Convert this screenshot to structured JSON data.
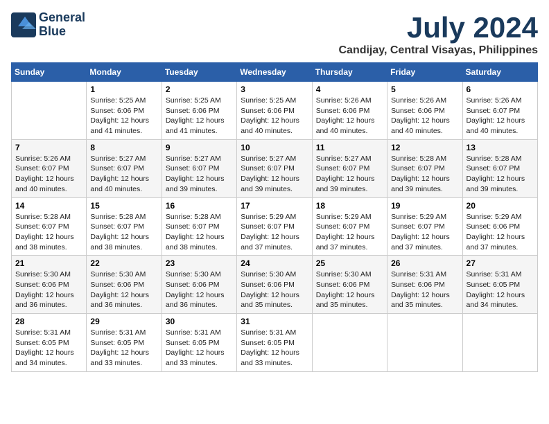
{
  "header": {
    "logo_line1": "General",
    "logo_line2": "Blue",
    "month_year": "July 2024",
    "location": "Candijay, Central Visayas, Philippines"
  },
  "days_of_week": [
    "Sunday",
    "Monday",
    "Tuesday",
    "Wednesday",
    "Thursday",
    "Friday",
    "Saturday"
  ],
  "weeks": [
    [
      {
        "num": "",
        "text": ""
      },
      {
        "num": "1",
        "text": "Sunrise: 5:25 AM\nSunset: 6:06 PM\nDaylight: 12 hours\nand 41 minutes."
      },
      {
        "num": "2",
        "text": "Sunrise: 5:25 AM\nSunset: 6:06 PM\nDaylight: 12 hours\nand 41 minutes."
      },
      {
        "num": "3",
        "text": "Sunrise: 5:25 AM\nSunset: 6:06 PM\nDaylight: 12 hours\nand 40 minutes."
      },
      {
        "num": "4",
        "text": "Sunrise: 5:26 AM\nSunset: 6:06 PM\nDaylight: 12 hours\nand 40 minutes."
      },
      {
        "num": "5",
        "text": "Sunrise: 5:26 AM\nSunset: 6:06 PM\nDaylight: 12 hours\nand 40 minutes."
      },
      {
        "num": "6",
        "text": "Sunrise: 5:26 AM\nSunset: 6:07 PM\nDaylight: 12 hours\nand 40 minutes."
      }
    ],
    [
      {
        "num": "7",
        "text": "Sunrise: 5:26 AM\nSunset: 6:07 PM\nDaylight: 12 hours\nand 40 minutes."
      },
      {
        "num": "8",
        "text": "Sunrise: 5:27 AM\nSunset: 6:07 PM\nDaylight: 12 hours\nand 40 minutes."
      },
      {
        "num": "9",
        "text": "Sunrise: 5:27 AM\nSunset: 6:07 PM\nDaylight: 12 hours\nand 39 minutes."
      },
      {
        "num": "10",
        "text": "Sunrise: 5:27 AM\nSunset: 6:07 PM\nDaylight: 12 hours\nand 39 minutes."
      },
      {
        "num": "11",
        "text": "Sunrise: 5:27 AM\nSunset: 6:07 PM\nDaylight: 12 hours\nand 39 minutes."
      },
      {
        "num": "12",
        "text": "Sunrise: 5:28 AM\nSunset: 6:07 PM\nDaylight: 12 hours\nand 39 minutes."
      },
      {
        "num": "13",
        "text": "Sunrise: 5:28 AM\nSunset: 6:07 PM\nDaylight: 12 hours\nand 39 minutes."
      }
    ],
    [
      {
        "num": "14",
        "text": "Sunrise: 5:28 AM\nSunset: 6:07 PM\nDaylight: 12 hours\nand 38 minutes."
      },
      {
        "num": "15",
        "text": "Sunrise: 5:28 AM\nSunset: 6:07 PM\nDaylight: 12 hours\nand 38 minutes."
      },
      {
        "num": "16",
        "text": "Sunrise: 5:28 AM\nSunset: 6:07 PM\nDaylight: 12 hours\nand 38 minutes."
      },
      {
        "num": "17",
        "text": "Sunrise: 5:29 AM\nSunset: 6:07 PM\nDaylight: 12 hours\nand 37 minutes."
      },
      {
        "num": "18",
        "text": "Sunrise: 5:29 AM\nSunset: 6:07 PM\nDaylight: 12 hours\nand 37 minutes."
      },
      {
        "num": "19",
        "text": "Sunrise: 5:29 AM\nSunset: 6:07 PM\nDaylight: 12 hours\nand 37 minutes."
      },
      {
        "num": "20",
        "text": "Sunrise: 5:29 AM\nSunset: 6:06 PM\nDaylight: 12 hours\nand 37 minutes."
      }
    ],
    [
      {
        "num": "21",
        "text": "Sunrise: 5:30 AM\nSunset: 6:06 PM\nDaylight: 12 hours\nand 36 minutes."
      },
      {
        "num": "22",
        "text": "Sunrise: 5:30 AM\nSunset: 6:06 PM\nDaylight: 12 hours\nand 36 minutes."
      },
      {
        "num": "23",
        "text": "Sunrise: 5:30 AM\nSunset: 6:06 PM\nDaylight: 12 hours\nand 36 minutes."
      },
      {
        "num": "24",
        "text": "Sunrise: 5:30 AM\nSunset: 6:06 PM\nDaylight: 12 hours\nand 35 minutes."
      },
      {
        "num": "25",
        "text": "Sunrise: 5:30 AM\nSunset: 6:06 PM\nDaylight: 12 hours\nand 35 minutes."
      },
      {
        "num": "26",
        "text": "Sunrise: 5:31 AM\nSunset: 6:06 PM\nDaylight: 12 hours\nand 35 minutes."
      },
      {
        "num": "27",
        "text": "Sunrise: 5:31 AM\nSunset: 6:05 PM\nDaylight: 12 hours\nand 34 minutes."
      }
    ],
    [
      {
        "num": "28",
        "text": "Sunrise: 5:31 AM\nSunset: 6:05 PM\nDaylight: 12 hours\nand 34 minutes."
      },
      {
        "num": "29",
        "text": "Sunrise: 5:31 AM\nSunset: 6:05 PM\nDaylight: 12 hours\nand 33 minutes."
      },
      {
        "num": "30",
        "text": "Sunrise: 5:31 AM\nSunset: 6:05 PM\nDaylight: 12 hours\nand 33 minutes."
      },
      {
        "num": "31",
        "text": "Sunrise: 5:31 AM\nSunset: 6:05 PM\nDaylight: 12 hours\nand 33 minutes."
      },
      {
        "num": "",
        "text": ""
      },
      {
        "num": "",
        "text": ""
      },
      {
        "num": "",
        "text": ""
      }
    ]
  ]
}
